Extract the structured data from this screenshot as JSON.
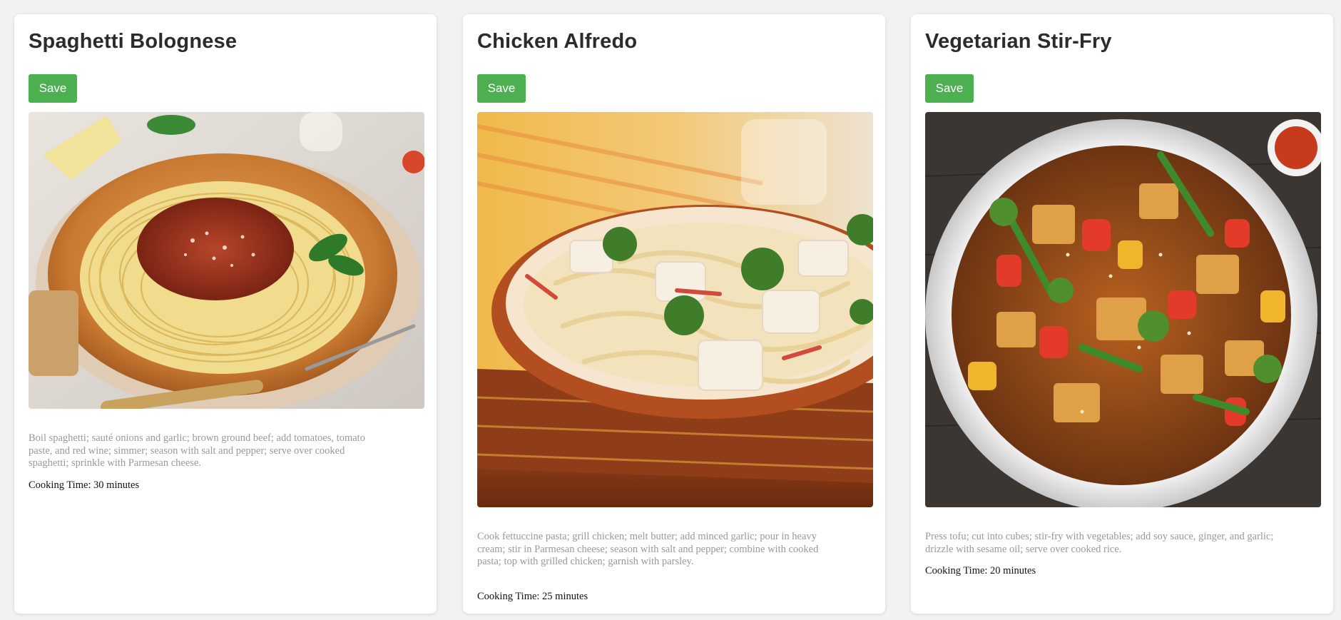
{
  "recipes": [
    {
      "title": "Spaghetti Bolognese",
      "save_label": "Save",
      "image_icon": "spaghetti-bolognese-photo",
      "description": "Boil spaghetti; sauté onions and garlic; brown ground beef; add tomatoes, tomato paste, and red wine; simmer; season with salt and pepper; serve over cooked spaghetti; sprinkle with Parmesan cheese.",
      "cooking_time": "Cooking Time: 30 minutes"
    },
    {
      "title": "Chicken Alfredo",
      "save_label": "Save",
      "image_icon": "chicken-alfredo-photo",
      "description": "Cook fettuccine pasta; grill chicken; melt butter; add minced garlic; pour in heavy cream; stir in Parmesan cheese; season with salt and pepper; combine with cooked pasta; top with grilled chicken; garnish with parsley.",
      "cooking_time": "Cooking Time: 25 minutes"
    },
    {
      "title": "Vegetarian Stir-Fry",
      "save_label": "Save",
      "image_icon": "vegetarian-stir-fry-photo",
      "description": "Press tofu; cut into cubes; stir-fry with vegetables; add soy sauce, ginger, and garlic; drizzle with sesame oil; serve over cooked rice.",
      "cooking_time": "Cooking Time: 20 minutes"
    }
  ],
  "colors": {
    "save_button": "#4caf50",
    "page_background": "#f2f2f2",
    "card_background": "#ffffff",
    "description_text": "#999999"
  }
}
